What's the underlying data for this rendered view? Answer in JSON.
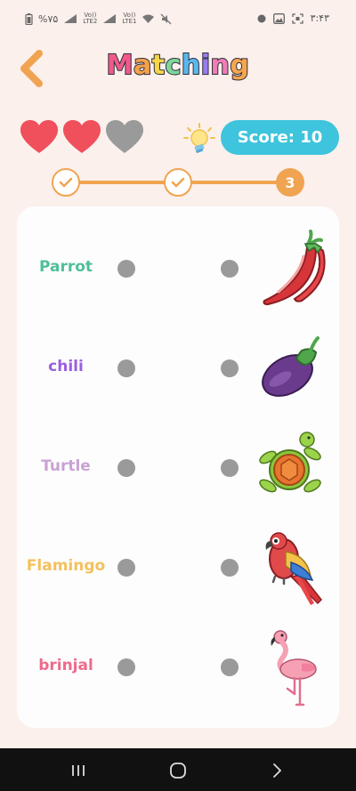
{
  "status_bar": {
    "battery_text": "%۷۵",
    "carrier1_top": "Vo))",
    "carrier1_bottom": "LTE2",
    "carrier2_top": "Vo))",
    "carrier2_bottom": "LTE1",
    "time": "۳:۴۳"
  },
  "header": {
    "title_letters": [
      "M",
      "a",
      "t",
      "c",
      "h",
      "i",
      "n",
      "g"
    ],
    "title_colors": [
      "#f05a8a",
      "#f3a14b",
      "#f7d54a",
      "#7fd69a",
      "#5ab8ef",
      "#9a7cf0",
      "#f07db5",
      "#f5a64f"
    ]
  },
  "lives": {
    "total": 3,
    "remaining": 2,
    "full_color": "#f04f5c",
    "empty_color": "#9a9a9a"
  },
  "score": {
    "label": "Score: 10"
  },
  "progress": {
    "steps": 3,
    "completed": 2,
    "current_label": "3"
  },
  "words": [
    {
      "text": "Parrot",
      "color": "#4fbf9a"
    },
    {
      "text": "chili",
      "color": "#9a5fe0"
    },
    {
      "text": "Turtle",
      "color": "#c9a2d4"
    },
    {
      "text": "Flamingo",
      "color": "#f5c05e"
    },
    {
      "text": "brinjal",
      "color": "#ee6b8b"
    }
  ],
  "pictures": [
    "chili-pepper",
    "eggplant",
    "turtle",
    "parrot",
    "flamingo"
  ]
}
